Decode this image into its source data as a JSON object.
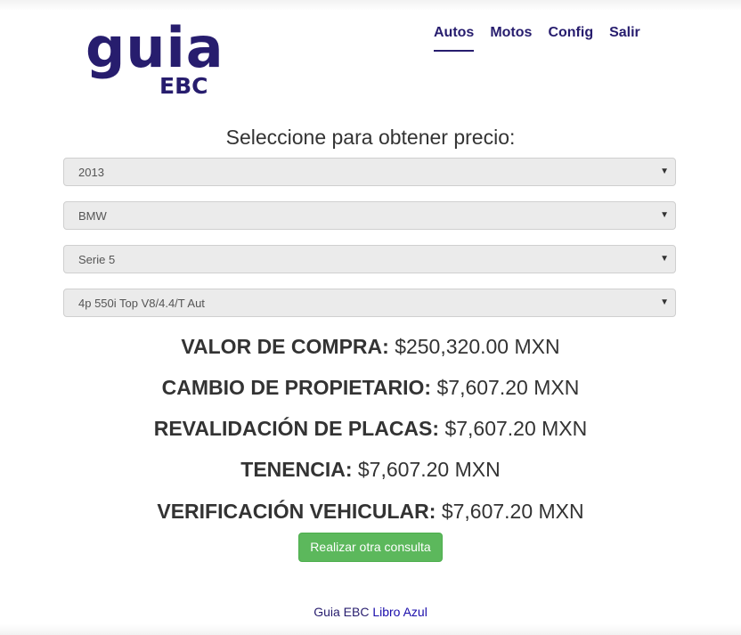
{
  "logo": {
    "main": "guia",
    "sub": "EBC"
  },
  "nav": {
    "items": [
      {
        "label": "Autos",
        "active": true
      },
      {
        "label": "Motos",
        "active": false
      },
      {
        "label": "Config",
        "active": false
      },
      {
        "label": "Salir",
        "active": false
      }
    ]
  },
  "form": {
    "prompt": "Seleccione para obtener precio:",
    "selects": [
      {
        "name": "year",
        "value": "2013"
      },
      {
        "name": "brand",
        "value": "BMW"
      },
      {
        "name": "model",
        "value": "Serie 5"
      },
      {
        "name": "version",
        "value": "4p 550i Top V8/4.4/T Aut"
      }
    ],
    "arrow_icon": "caret-down-icon"
  },
  "results": [
    {
      "label": "VALOR DE COMPRA:",
      "value": "$250,320.00 MXN"
    },
    {
      "label": "CAMBIO DE PROPIETARIO:",
      "value": "$7,607.20 MXN"
    },
    {
      "label": "REVALIDACIÓN DE PLACAS:",
      "value": "$7,607.20 MXN"
    },
    {
      "label": "TENENCIA:",
      "value": "$7,607.20 MXN"
    },
    {
      "label": "VERIFICACIÓN VEHICULAR:",
      "value": "$7,607.20 MXN"
    }
  ],
  "actions": {
    "new_query_label": "Realizar otra consulta"
  },
  "footer": {
    "prefix": "Guia EBC",
    "link": "Libro Azul"
  },
  "colors": {
    "brand": "#271d6e",
    "button": "#5cb85c",
    "select_bg": "#ebebeb"
  }
}
